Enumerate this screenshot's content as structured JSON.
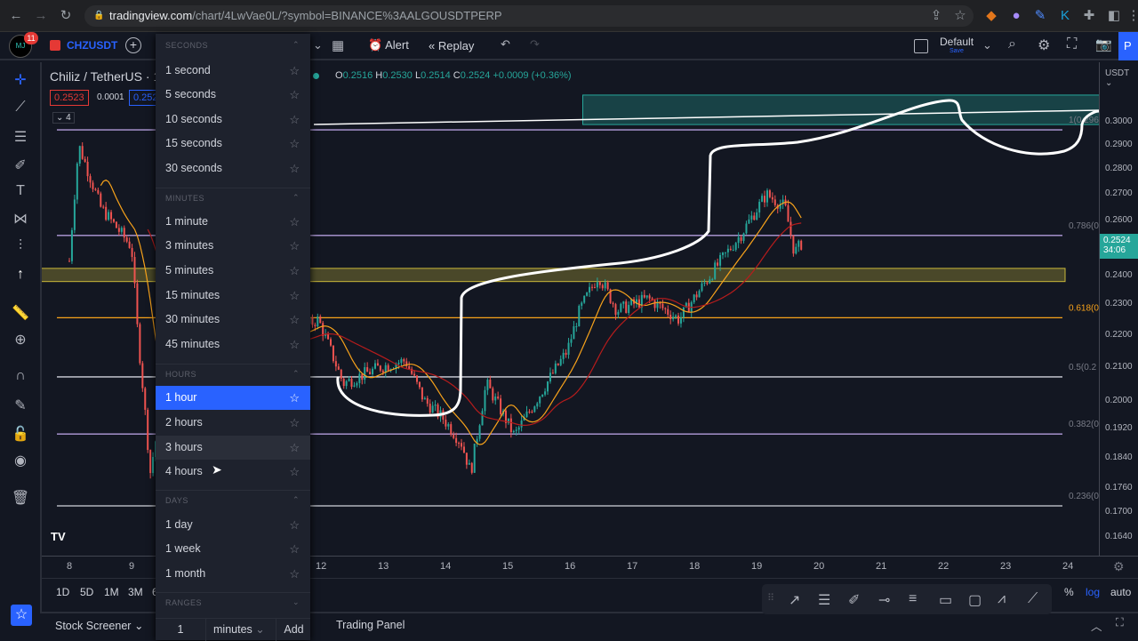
{
  "browser": {
    "url_host": "tradingview.com",
    "url_path": "/chart/4LwVae0L/?symbol=BINANCE%3AALGOUSDTPERP"
  },
  "topbar": {
    "avatar": "MJ",
    "notifications": "11",
    "symbol": "CHZUSDT",
    "alert": "Alert",
    "replay": "Replay",
    "layout_name": "Default",
    "layout_sub": "Save",
    "publish": "P"
  },
  "legend": {
    "title": "Chiliz / TetherUS · 1",
    "sell": "0.2523",
    "spread": "0.0001",
    "buy": "0.252",
    "collapsed_count": "4",
    "ohlc": {
      "o_label": "O",
      "o": "0.2516",
      "h_label": "H",
      "h": "0.2530",
      "l_label": "L",
      "l": "0.2514",
      "c_label": "C",
      "c": "0.2524",
      "change": "+0.0009 (+0.36%)"
    }
  },
  "interval_menu": {
    "sections": [
      {
        "title": "SECONDS",
        "items": [
          "1 second",
          "5 seconds",
          "10 seconds",
          "15 seconds",
          "30 seconds"
        ]
      },
      {
        "title": "MINUTES",
        "items": [
          "1 minute",
          "3 minutes",
          "5 minutes",
          "15 minutes",
          "30 minutes",
          "45 minutes"
        ]
      },
      {
        "title": "HOURS",
        "items": [
          "1 hour",
          "2 hours",
          "3 hours",
          "4 hours"
        ]
      },
      {
        "title": "DAYS",
        "items": [
          "1 day",
          "1 week",
          "1 month"
        ]
      },
      {
        "title": "RANGES",
        "items": []
      }
    ],
    "selected": "1 hour",
    "hovered": "3 hours",
    "custom": {
      "value": "1",
      "unit": "minutes",
      "add": "Add"
    }
  },
  "price_axis": {
    "currency": "USDT",
    "ticks": [
      "0.3000",
      "0.2900",
      "0.2800",
      "0.2700",
      "0.2600",
      "0.2400",
      "0.2300",
      "0.2200",
      "0.2100",
      "0.2000",
      "0.1920",
      "0.1840",
      "0.1760",
      "0.1700",
      "0.1640"
    ],
    "last_price": "0.2524",
    "countdown": "34:06",
    "scale": "log",
    "last_color": "#26a69a"
  },
  "time_axis": {
    "ticks": [
      "8",
      "9",
      "12",
      "13",
      "14",
      "15",
      "16",
      "17",
      "18",
      "19",
      "20",
      "21",
      "22",
      "23",
      "24"
    ]
  },
  "fib_labels": [
    "1(0.296",
    "0.786(0",
    "0.618(0",
    "0.5(0.2",
    "0.382(0",
    "0.236(0"
  ],
  "chart_data": {
    "type": "candlestick",
    "x_unit": "day of month",
    "scale": "log",
    "close_path": [
      [
        8.0,
        0.245
      ],
      [
        8.15,
        0.29
      ],
      [
        8.5,
        0.265
      ],
      [
        9.0,
        0.25
      ],
      [
        9.1,
        0.22
      ],
      [
        9.3,
        0.18
      ],
      [
        9.6,
        0.21
      ],
      [
        11.5,
        0.22
      ],
      [
        12.0,
        0.225
      ],
      [
        12.4,
        0.205
      ],
      [
        13.0,
        0.21
      ],
      [
        13.4,
        0.212
      ],
      [
        13.7,
        0.2
      ],
      [
        14.0,
        0.195
      ],
      [
        14.3,
        0.188
      ],
      [
        14.45,
        0.18
      ],
      [
        14.7,
        0.205
      ],
      [
        15.0,
        0.195
      ],
      [
        15.15,
        0.19
      ],
      [
        15.5,
        0.2
      ],
      [
        16.0,
        0.215
      ],
      [
        16.2,
        0.228
      ],
      [
        16.5,
        0.24
      ],
      [
        16.8,
        0.228
      ],
      [
        17.3,
        0.232
      ],
      [
        17.8,
        0.225
      ],
      [
        18.3,
        0.24
      ],
      [
        18.8,
        0.255
      ],
      [
        19.2,
        0.27
      ],
      [
        19.5,
        0.265
      ],
      [
        19.65,
        0.248
      ],
      [
        19.8,
        0.2524
      ]
    ],
    "fib_levels": [
      0.2965,
      0.2543,
      0.2256,
      0.207,
      0.1905,
      0.1716
    ],
    "zones": [
      {
        "from": 8.0,
        "to": 24.0,
        "low": 0.2378,
        "high": 0.2424,
        "color": "#c9b83a"
      },
      {
        "from": 16.25,
        "to": 24.0,
        "low": 0.2988,
        "high": 0.3119,
        "color": "#26a69a"
      }
    ],
    "up_color": "#26a69a",
    "down_color": "#ef5350",
    "ma_fast_color": "#f7a21b",
    "ma_slow_color": "#b71c1c"
  },
  "bottom": {
    "ranges": [
      "1D",
      "5D",
      "1M",
      "3M",
      "6"
    ],
    "percent": "%",
    "log": "log",
    "auto": "auto",
    "screener": "Stock Screener",
    "trading_panel": "Trading Panel"
  }
}
